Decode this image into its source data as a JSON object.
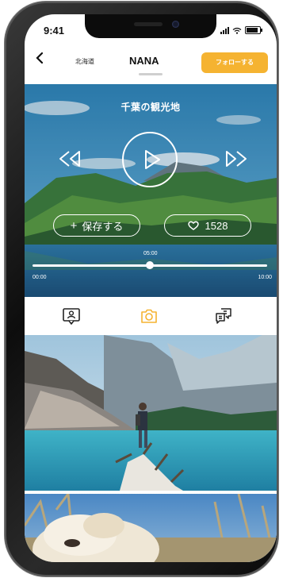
{
  "status_bar": {
    "time": "9:41"
  },
  "header": {
    "back_icon": "chevron-left-icon",
    "location": "北海道",
    "name": "NANA",
    "follow_label": "フォローする",
    "accent_color": "#f5b331"
  },
  "player": {
    "title": "千葉の観光地",
    "save_label": "保存する",
    "like_count": "1528",
    "current_time": "05:00",
    "start_time": "00:00",
    "end_time": "10:00",
    "progress_fraction": 0.5
  },
  "tabs": [
    {
      "icon": "profile-card-icon",
      "active": false
    },
    {
      "icon": "camera-icon",
      "active": true
    },
    {
      "icon": "chat-bubbles-icon",
      "active": false
    }
  ],
  "photos": [
    {
      "subject": "hiker standing on log by mountain lake"
    },
    {
      "subject": "alpaca in grass"
    }
  ]
}
